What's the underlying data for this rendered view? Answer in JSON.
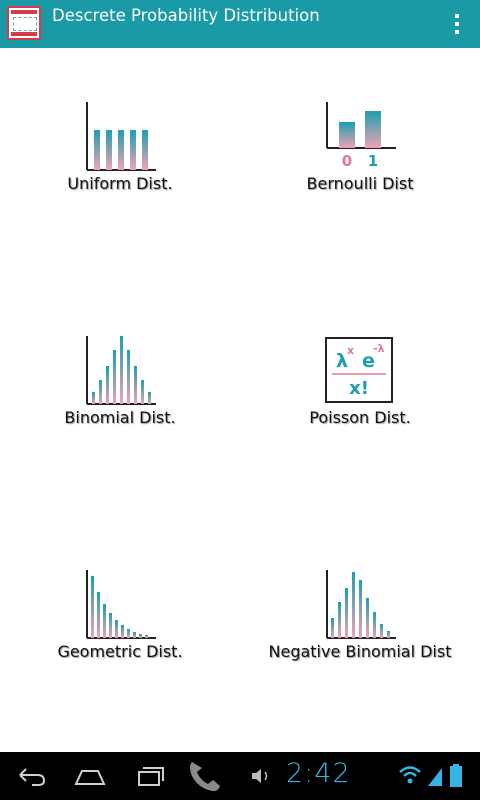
{
  "app": {
    "title": "Descrete Probability Distribution"
  },
  "colors": {
    "accent": "#1a9aa6",
    "pink": "#e0788f",
    "teal": "#1ba0b0",
    "clock": "#33b5e5"
  },
  "icons": {
    "app": "app-logo-icon",
    "overflow": "overflow-menu-icon",
    "back": "back-icon",
    "home": "home-icon",
    "recents": "recent-apps-icon",
    "phone": "phone-icon",
    "volume": "volume-icon",
    "wifi": "wifi-icon",
    "signal": "signal-icon",
    "battery": "battery-icon"
  },
  "tiles": [
    {
      "label": "Uniform Dist.",
      "icon": "uniform-chart-icon"
    },
    {
      "label": "Bernoulli Dist",
      "icon": "bernoulli-chart-icon",
      "axis_labels": [
        "0",
        "1"
      ]
    },
    {
      "label": "Binomial Dist.",
      "icon": "binomial-chart-icon"
    },
    {
      "label": "Poisson Dist.",
      "icon": "poisson-formula-icon",
      "formula": {
        "lambda": "λ",
        "x": "x",
        "e": "e",
        "exp": "-λ",
        "den": "x!"
      }
    },
    {
      "label": "Geometric Dist.",
      "icon": "geometric-chart-icon"
    },
    {
      "label": "Negative Binomial Dist",
      "icon": "negative-binomial-chart-icon"
    }
  ],
  "statusbar": {
    "time": "2:42"
  }
}
